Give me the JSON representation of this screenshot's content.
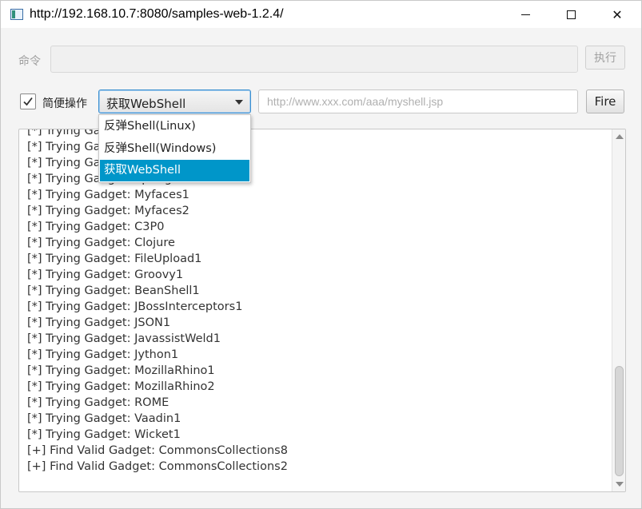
{
  "window": {
    "title": "http://192.168.10.7:8080/samples-web-1.2.4/",
    "minimize_icon": "minimize-icon",
    "maximize_icon": "maximize-icon",
    "close_label": "✕"
  },
  "command": {
    "label": "命令",
    "value": "",
    "execute_label": "执行"
  },
  "options": {
    "simple_mode_label": "简便操作",
    "simple_mode_checked": true,
    "mode_selected": "获取WebShell",
    "mode_options": [
      "反弹Shell(Linux)",
      "反弹Shell(Windows)",
      "获取WebShell"
    ],
    "url_placeholder": "http://www.xxx.com/aaa/myshell.jsp",
    "fire_label": "Fire"
  },
  "log": {
    "lines": [
      "[*] Trying Gadget: Spring1",
      "[*] Trying Gadget: Spring2",
      "[*] Trying Gadget: Spring3",
      "[*] Trying Gadget: Spring4",
      "[*] Trying Gadget: Myfaces1",
      "[*] Trying Gadget: Myfaces2",
      "[*] Trying Gadget: C3P0",
      "[*] Trying Gadget: Clojure",
      "[*] Trying Gadget: FileUpload1",
      "[*] Trying Gadget: Groovy1",
      "[*] Trying Gadget: BeanShell1",
      "[*] Trying Gadget: JBossInterceptors1",
      "[*] Trying Gadget: JSON1",
      "[*] Trying Gadget: JavassistWeld1",
      "[*] Trying Gadget: Jython1",
      "[*] Trying Gadget: MozillaRhino1",
      "[*] Trying Gadget: MozillaRhino2",
      "[*] Trying Gadget: ROME",
      "[*] Trying Gadget: Vaadin1",
      "[*] Trying Gadget: Wicket1",
      "[+] Find Valid Gadget: CommonsCollections8",
      "[+] Find Valid Gadget: CommonsCollections2"
    ]
  },
  "colors": {
    "accent": "#0096c9",
    "focus_border": "#3a8fd0"
  }
}
